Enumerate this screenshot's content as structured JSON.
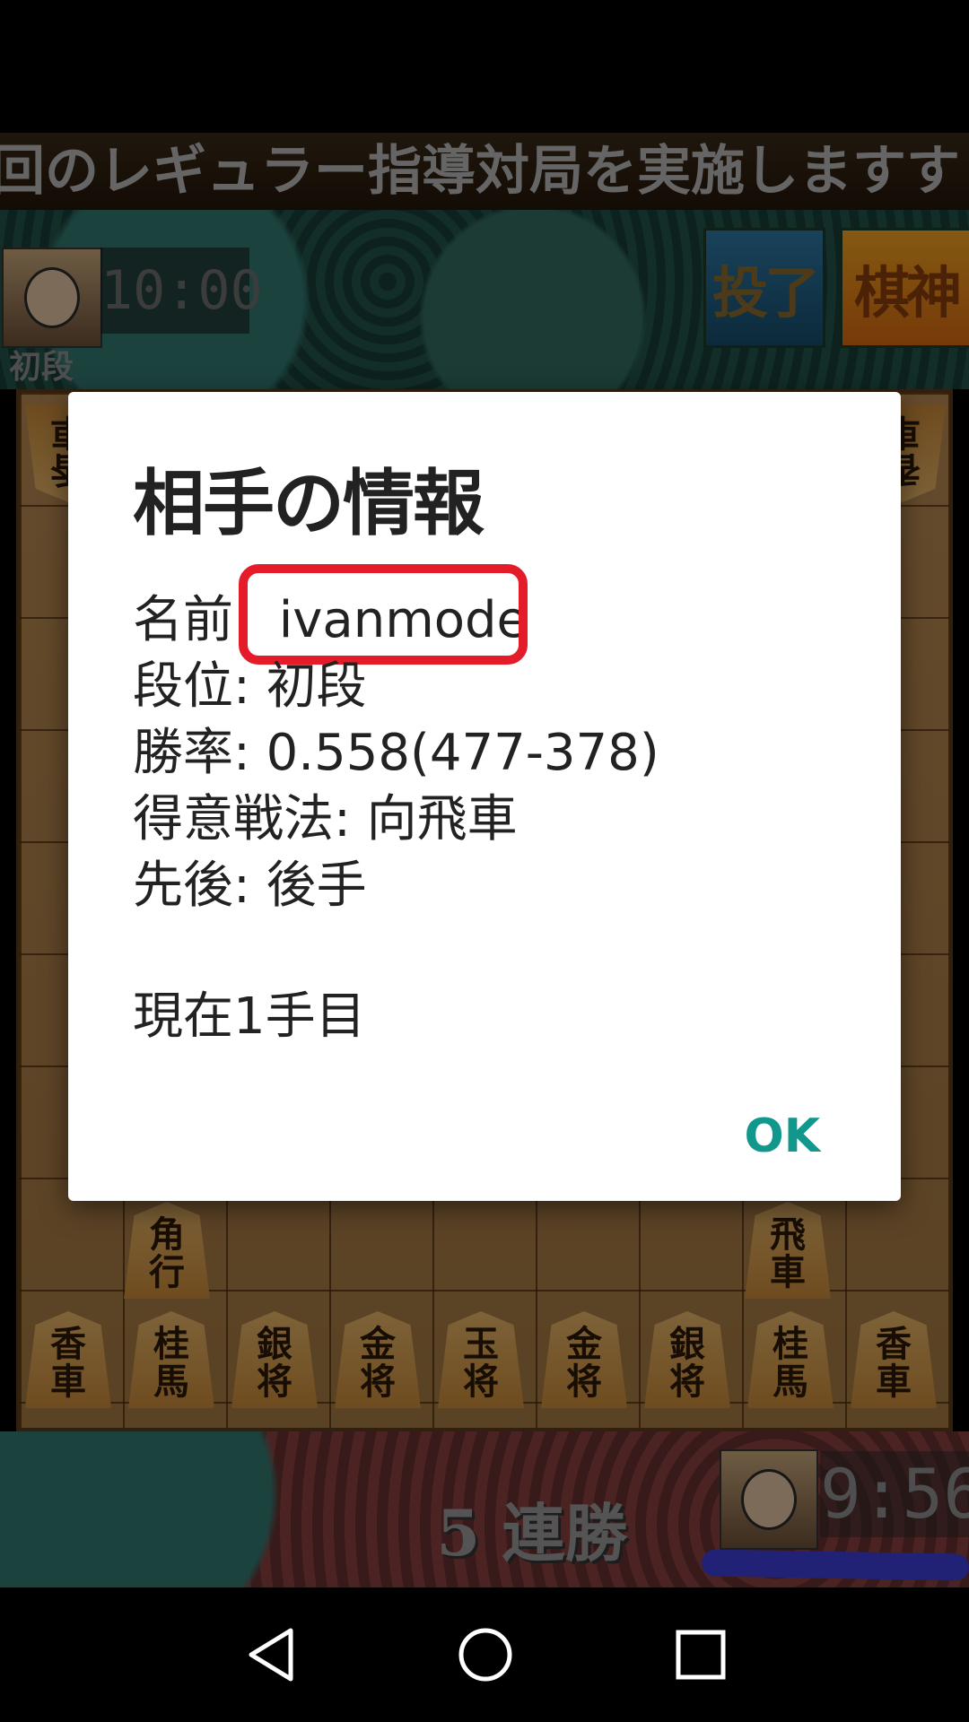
{
  "game": {
    "ticker": "回のレギュラー指導対局を実施しますす",
    "opponent_clock": "10:00",
    "opponent_rank": "初段",
    "resign_label": "投了",
    "kishin_label": "棋神",
    "streak": "5 連勝",
    "player_clock": "9:56",
    "pieces_top": [
      "香車",
      "",
      "",
      "",
      "",
      "",
      "",
      "",
      "香車"
    ],
    "pieces_bottom_row": [
      "香車",
      "桂馬",
      "銀将",
      "金将",
      "玉将",
      "金将",
      "銀将",
      "桂馬",
      "香車"
    ],
    "bishop": "角行",
    "rook": "飛車"
  },
  "dialog": {
    "title": "相手の情報",
    "name_label": "名前:",
    "name_value": "ivanmode",
    "rank_line": "段位: 初段",
    "rate_line": "勝率: 0.558(477-378)",
    "style_line": "得意戦法: 向飛車",
    "order_line": "先後: 後手",
    "move_line": "現在1手目",
    "ok_label": "OK"
  },
  "colors": {
    "highlight": "#e41c2a",
    "ok": "#11978c",
    "scribble": "#3d3dd8"
  }
}
